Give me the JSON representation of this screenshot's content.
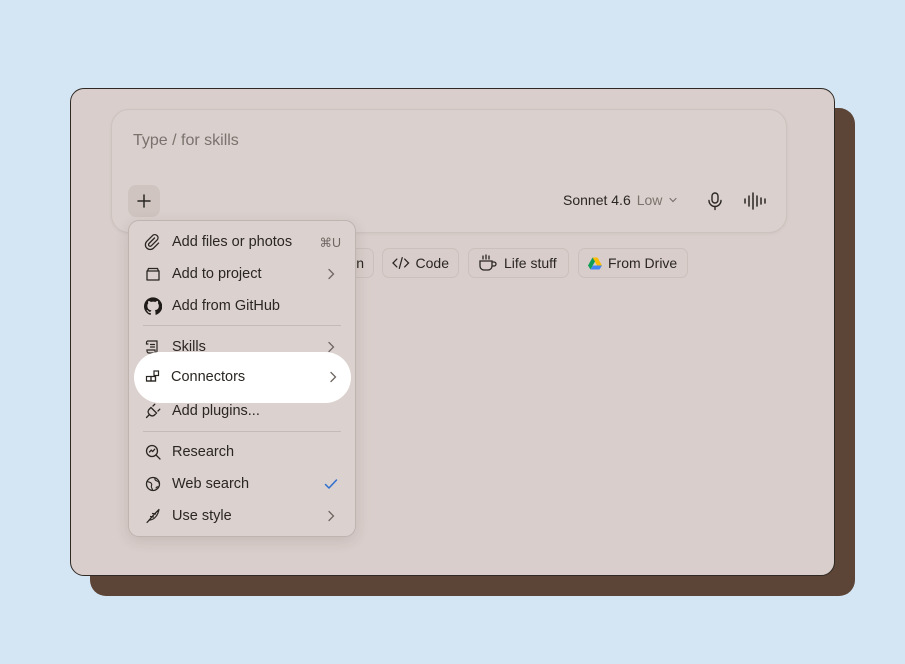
{
  "composer": {
    "placeholder": "Type / for skills",
    "model": "Sonnet 4.6",
    "effort": "Low"
  },
  "chips": [
    {
      "label": "n",
      "icon": "partial-chip"
    },
    {
      "label": "Code",
      "icon": "code-icon"
    },
    {
      "label": "Life stuff",
      "icon": "coffee-cup-icon"
    },
    {
      "label": "From Drive",
      "icon": "google-drive-icon"
    }
  ],
  "menu": {
    "items": [
      {
        "label": "Add files or photos",
        "shortcut": "⌘U",
        "icon": "paperclip-icon"
      },
      {
        "label": "Add to project",
        "icon": "project-box-icon",
        "submenu": true
      },
      {
        "label": "Add from GitHub",
        "icon": "github-icon"
      },
      {
        "label": "Skills",
        "icon": "scroll-icon",
        "submenu": true
      },
      {
        "label": "Connectors",
        "icon": "connectors-icon",
        "submenu": true,
        "highlighted": true
      },
      {
        "label": "Add plugins...",
        "icon": "plug-icon"
      },
      {
        "label": "Research",
        "icon": "research-icon"
      },
      {
        "label": "Web search",
        "icon": "globe-icon",
        "checked": true
      },
      {
        "label": "Use style",
        "icon": "quill-icon",
        "submenu": true
      }
    ]
  },
  "colors": {
    "background": "#d4e6f4",
    "card": "#d9cecb",
    "shadow_card": "#5c4436",
    "check": "#2f6fd0"
  }
}
